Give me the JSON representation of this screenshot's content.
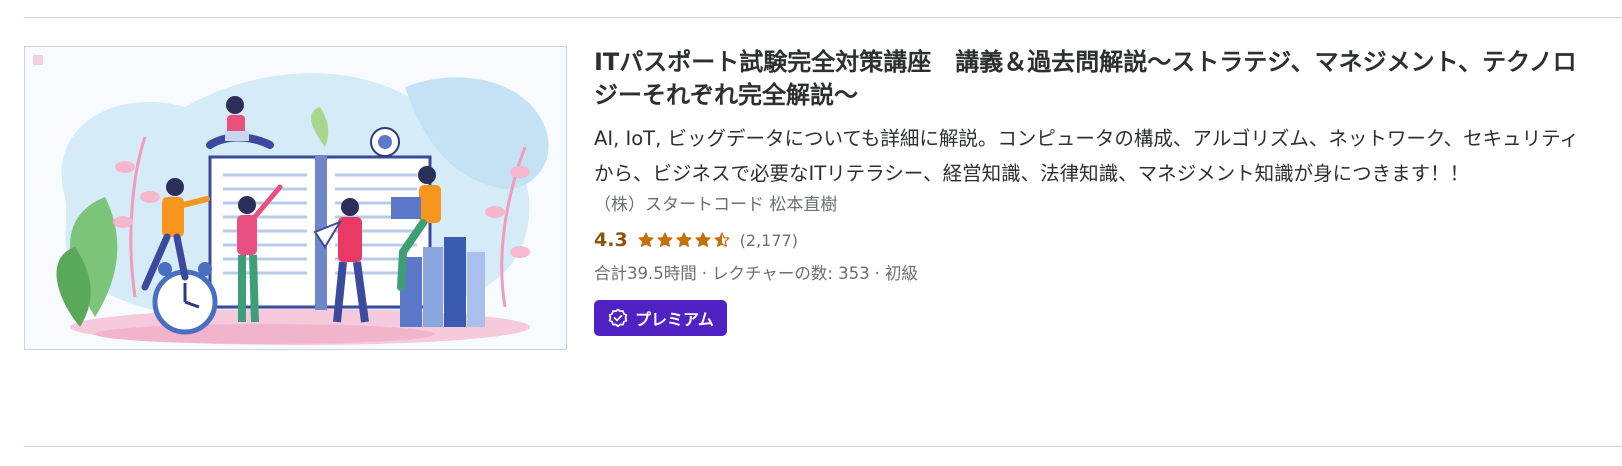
{
  "course": {
    "title": "ITパスポート試験完全対策講座　講義＆過去問解説〜ストラテジ、マネジメント、テクノロジーそれぞれ完全解説〜",
    "headline": "AI, IoT, ビッグデータについても詳細に解説。コンピュータの構成、アルゴリズム、ネットワーク、セキュリティから、ビジネスで必要なITリテラシー、経営知識、法律知識、マネジメント知識が身につきます！！",
    "instructor": "（株）スタートコード 松本直樹",
    "rating": "4.3",
    "rating_score": 4.3,
    "rating_count": "(2,177)",
    "total_hours": "合計39.5時間",
    "lectures": "レクチャーの数: 353",
    "level": "初級",
    "meta_separator": "·",
    "badge": "プレミアム"
  },
  "colors": {
    "rating": "#8c5309",
    "star": "#c4710d",
    "badge_bg": "#5022c3",
    "divider": "#d1d2e0"
  },
  "icons": {
    "star": "star-icon",
    "badge": "premium-seal-icon"
  }
}
